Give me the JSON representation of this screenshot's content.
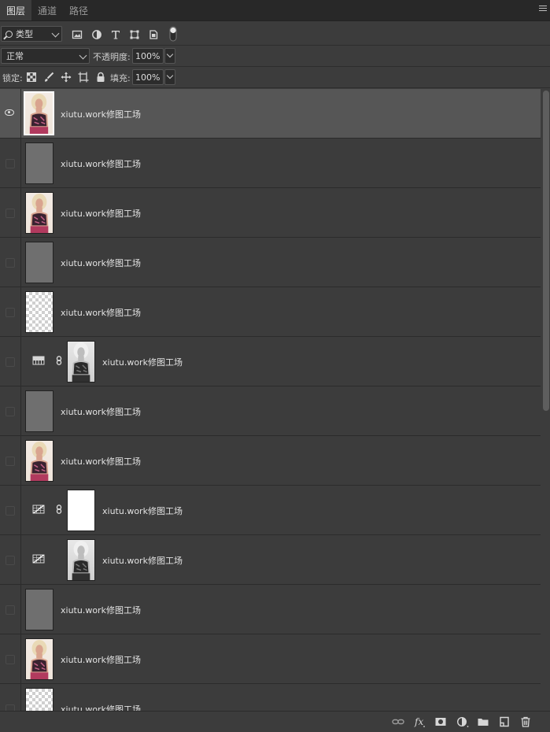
{
  "tabs": [
    {
      "label": "图层",
      "active": true
    },
    {
      "label": "通道",
      "active": false
    },
    {
      "label": "路径",
      "active": false
    }
  ],
  "filter": {
    "type_label": "类型",
    "icons": [
      "image-filter-icon",
      "adjustment-filter-icon",
      "type-filter-icon",
      "shape-filter-icon",
      "smart-object-filter-icon",
      "filter-toggle-icon"
    ]
  },
  "blend": {
    "mode": "正常",
    "opacity_label": "不透明度:",
    "opacity_value": "100%"
  },
  "lock": {
    "label": "锁定:",
    "icons": [
      "lock-transparent-icon",
      "lock-image-icon",
      "lock-position-icon",
      "lock-artboard-icon",
      "lock-all-icon"
    ],
    "fill_label": "填充:",
    "fill_value": "100%"
  },
  "layers": [
    {
      "name": "xiutu.work修图工场",
      "thumb": "photo",
      "visible": true,
      "selected": true,
      "adjustment": null
    },
    {
      "name": "xiutu.work修图工场",
      "thumb": "gray",
      "visible": false,
      "selected": false,
      "adjustment": null
    },
    {
      "name": "xiutu.work修图工场",
      "thumb": "photo",
      "visible": false,
      "selected": false,
      "adjustment": null
    },
    {
      "name": "xiutu.work修图工场",
      "thumb": "gray",
      "visible": false,
      "selected": false,
      "adjustment": null
    },
    {
      "name": "xiutu.work修图工场",
      "thumb": "checker",
      "visible": false,
      "selected": false,
      "adjustment": null
    },
    {
      "name": "xiutu.work修图工场",
      "thumb": "bw",
      "visible": false,
      "selected": false,
      "adjustment": "gradient-map",
      "linked": true
    },
    {
      "name": "xiutu.work修图工场",
      "thumb": "gray",
      "visible": false,
      "selected": false,
      "adjustment": null
    },
    {
      "name": "xiutu.work修图工场",
      "thumb": "photo",
      "visible": false,
      "selected": false,
      "adjustment": null
    },
    {
      "name": "xiutu.work修图工场",
      "thumb": "white",
      "visible": false,
      "selected": false,
      "adjustment": "curves",
      "linked": true
    },
    {
      "name": "xiutu.work修图工场",
      "thumb": "bw",
      "visible": false,
      "selected": false,
      "adjustment": "curves",
      "linked": false
    },
    {
      "name": "xiutu.work修图工场",
      "thumb": "gray",
      "visible": false,
      "selected": false,
      "adjustment": null
    },
    {
      "name": "xiutu.work修图工场",
      "thumb": "photo",
      "visible": false,
      "selected": false,
      "adjustment": null
    },
    {
      "name": "xiutu.work修图工场",
      "thumb": "checker",
      "visible": false,
      "selected": false,
      "adjustment": null
    }
  ],
  "bottom_icons": [
    "link-layers-icon",
    "fx-icon",
    "add-mask-icon",
    "new-adjustment-icon",
    "new-group-icon",
    "new-layer-icon",
    "delete-layer-icon"
  ]
}
